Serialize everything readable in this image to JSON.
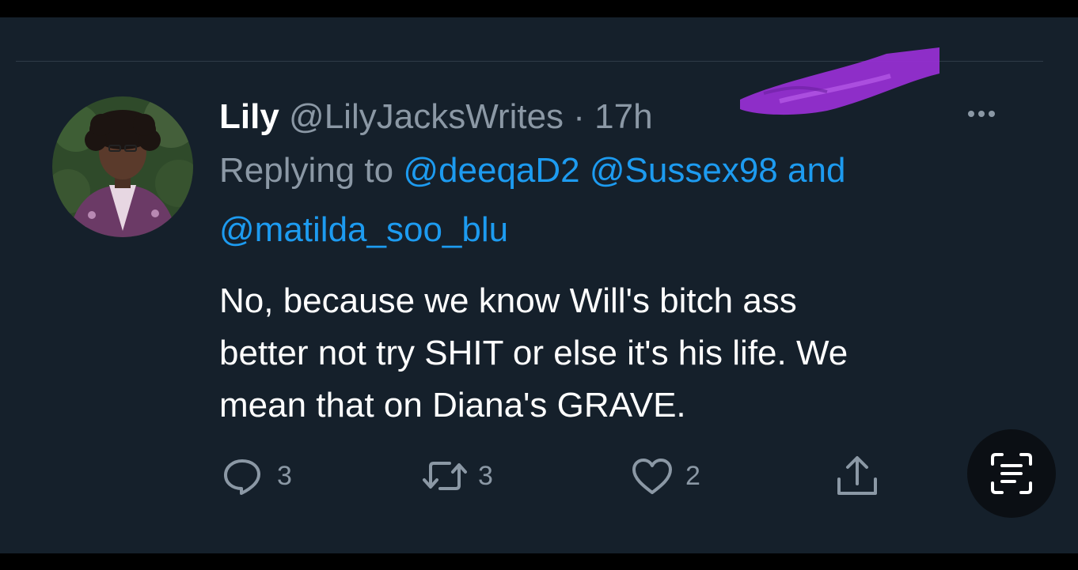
{
  "tweet": {
    "display_name": "Lily",
    "handle": "@LilyJacksWrites",
    "separator": "·",
    "timestamp": "17h",
    "replying_to_label": "Replying to",
    "mentions": [
      "@deeqaD2",
      "@Sussex98",
      "@matilda_soo_blu"
    ],
    "mentions_joiner": "and",
    "text_lines": [
      "No, because we know Will's bitch ass",
      "better not try SHIT or else it's his life. We",
      "mean that on Diana's GRAVE."
    ]
  },
  "actions": {
    "reply_count": "3",
    "retweet_count": "3",
    "like_count": "2"
  },
  "icons": {
    "more": "more-horizontal-icon",
    "reply": "reply-bubble-icon",
    "retweet": "retweet-icon",
    "like": "heart-icon",
    "share": "share-icon",
    "lens": "text-scan-icon"
  },
  "colors": {
    "background": "#15202b",
    "text": "#ffffff",
    "muted": "#8b98a5",
    "link": "#1d9bf0",
    "scribble": "#9b30d9"
  }
}
